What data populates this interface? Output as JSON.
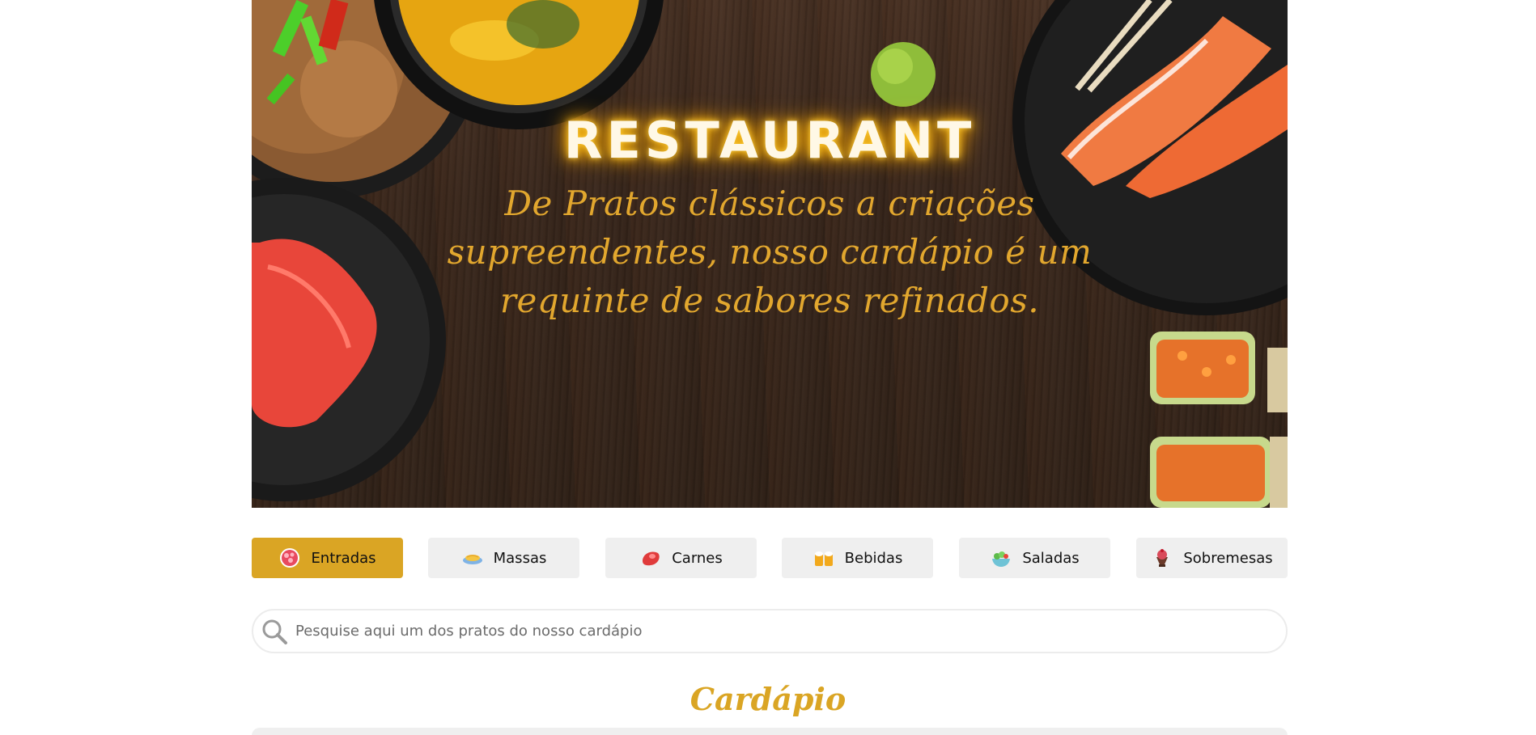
{
  "hero": {
    "title": "RESTAURANT",
    "subtitle": "De Pratos clássicos a criações supreendentes, nosso cardápio é um requinte de sabores refinados."
  },
  "categories": [
    {
      "label": "Entradas",
      "icon": "appetizer-icon",
      "active": true
    },
    {
      "label": "Massas",
      "icon": "pasta-icon",
      "active": false
    },
    {
      "label": "Carnes",
      "icon": "meat-icon",
      "active": false
    },
    {
      "label": "Bebidas",
      "icon": "drinks-icon",
      "active": false
    },
    {
      "label": "Saladas",
      "icon": "salad-icon",
      "active": false
    },
    {
      "label": "Sobremesas",
      "icon": "dessert-icon",
      "active": false
    }
  ],
  "search": {
    "placeholder": "Pesquise aqui um dos pratos do nosso cardápio"
  },
  "menu": {
    "title": "Cardápio"
  },
  "colors": {
    "accent": "#daa524",
    "button_bg": "#efefef",
    "title_glow": "#ffb400"
  }
}
